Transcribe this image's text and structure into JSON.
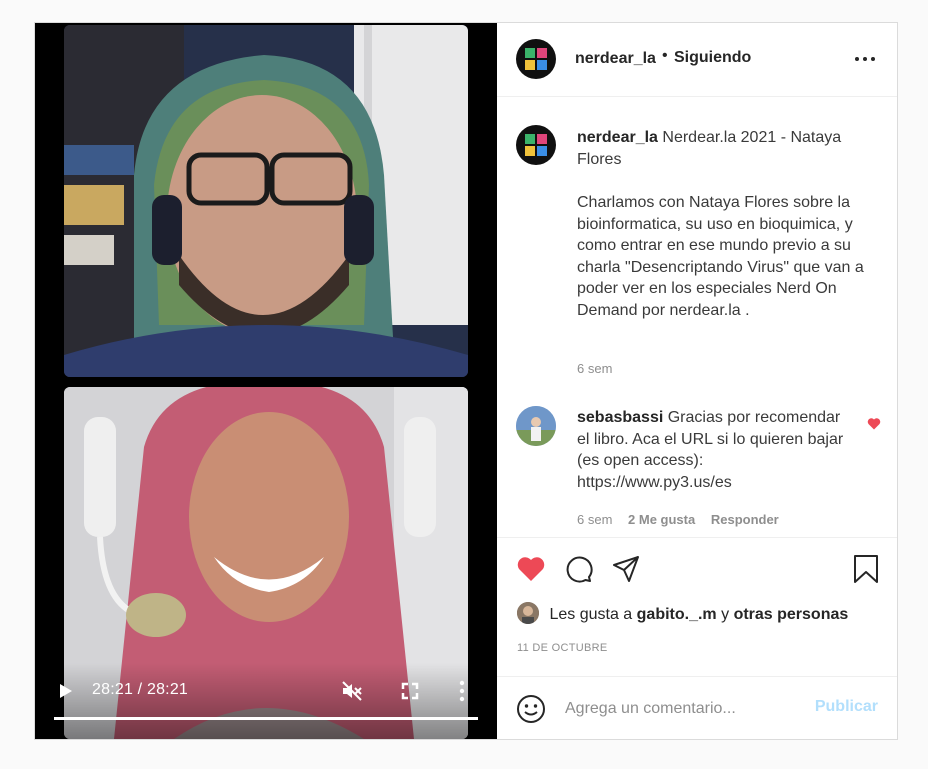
{
  "post": {
    "author": "nerdear_la",
    "separator": "•",
    "follow_status": "Siguiendo",
    "caption_author": "nerdear_la",
    "caption_title": "Nerdear.la 2021 - Nataya Flores",
    "caption_body": "Charlamos con Nataya Flores sobre la bioinformatica, su uso en bioquimica, y como entrar en ese mundo previo a su charla \"Desencriptando Virus\" que van a poder ver en los especiales Nerd On Demand por nerdear.la .",
    "caption_time": "6 sem"
  },
  "comment": {
    "author": "sebasbassi",
    "text": "Gracias por recomendar el libro. Aca el URL si lo quieren bajar (es open access): https://www.py3.us/es",
    "time": "6 sem",
    "likes": "2 Me gusta",
    "reply": "Responder"
  },
  "likes": {
    "prefix": "Les gusta a",
    "user": "gabito._.m",
    "conjunction": "y",
    "others": "otras personas"
  },
  "date": "11 DE OCTUBRE",
  "add_comment": {
    "placeholder": "Agrega un comentario...",
    "publish": "Publicar"
  },
  "video": {
    "time": "28:21 / 28:21",
    "progress": 1.0
  },
  "colors": {
    "like_red": "#ed4956",
    "publish_blue": "#b2dffc",
    "muted_text": "#8e8e8e"
  },
  "icons": [
    "play-icon",
    "mute-icon",
    "fullscreen-icon",
    "more-vertical-icon",
    "more-horizontal-icon",
    "heart-icon",
    "comment-icon",
    "share-icon",
    "bookmark-icon",
    "smile-icon"
  ]
}
